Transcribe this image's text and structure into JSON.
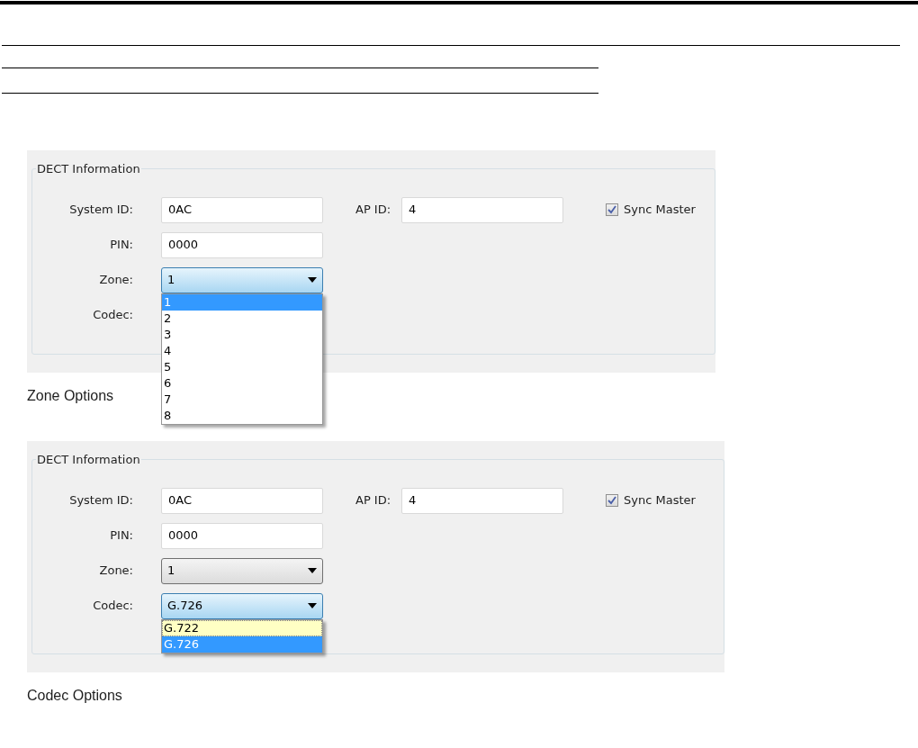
{
  "figures": [
    {
      "title": "DECT Information",
      "system_id": {
        "label": "System ID:",
        "value": "0AC"
      },
      "ap_id": {
        "label": "AP ID:",
        "value": "4"
      },
      "sync_master": {
        "label": "Sync Master",
        "checked": true
      },
      "pin": {
        "label": "PIN:",
        "value": "0000"
      },
      "zone": {
        "label": "Zone:",
        "value": "1",
        "focused": true,
        "options": [
          {
            "label": "1",
            "selected": true,
            "hovered": false
          },
          {
            "label": "2",
            "selected": false,
            "hovered": false
          },
          {
            "label": "3",
            "selected": false,
            "hovered": false
          },
          {
            "label": "4",
            "selected": false,
            "hovered": false
          },
          {
            "label": "5",
            "selected": false,
            "hovered": false
          },
          {
            "label": "6",
            "selected": false,
            "hovered": false
          },
          {
            "label": "7",
            "selected": false,
            "hovered": false
          },
          {
            "label": "8",
            "selected": false,
            "hovered": false
          }
        ]
      },
      "codec": {
        "label": "Codec:"
      },
      "caption": "Zone Options"
    },
    {
      "title": "DECT Information",
      "system_id": {
        "label": "System ID:",
        "value": "0AC"
      },
      "ap_id": {
        "label": "AP ID:",
        "value": "4"
      },
      "sync_master": {
        "label": "Sync Master",
        "checked": true
      },
      "pin": {
        "label": "PIN:",
        "value": "0000"
      },
      "zone": {
        "label": "Zone:",
        "value": "1",
        "focused": false
      },
      "codec": {
        "label": "Codec:",
        "value": "G.726",
        "focused": true,
        "options": [
          {
            "label": "G.722",
            "selected": false,
            "hovered": true
          },
          {
            "label": "G.726",
            "selected": true,
            "hovered": false
          }
        ]
      },
      "caption": "Codec Options"
    }
  ]
}
